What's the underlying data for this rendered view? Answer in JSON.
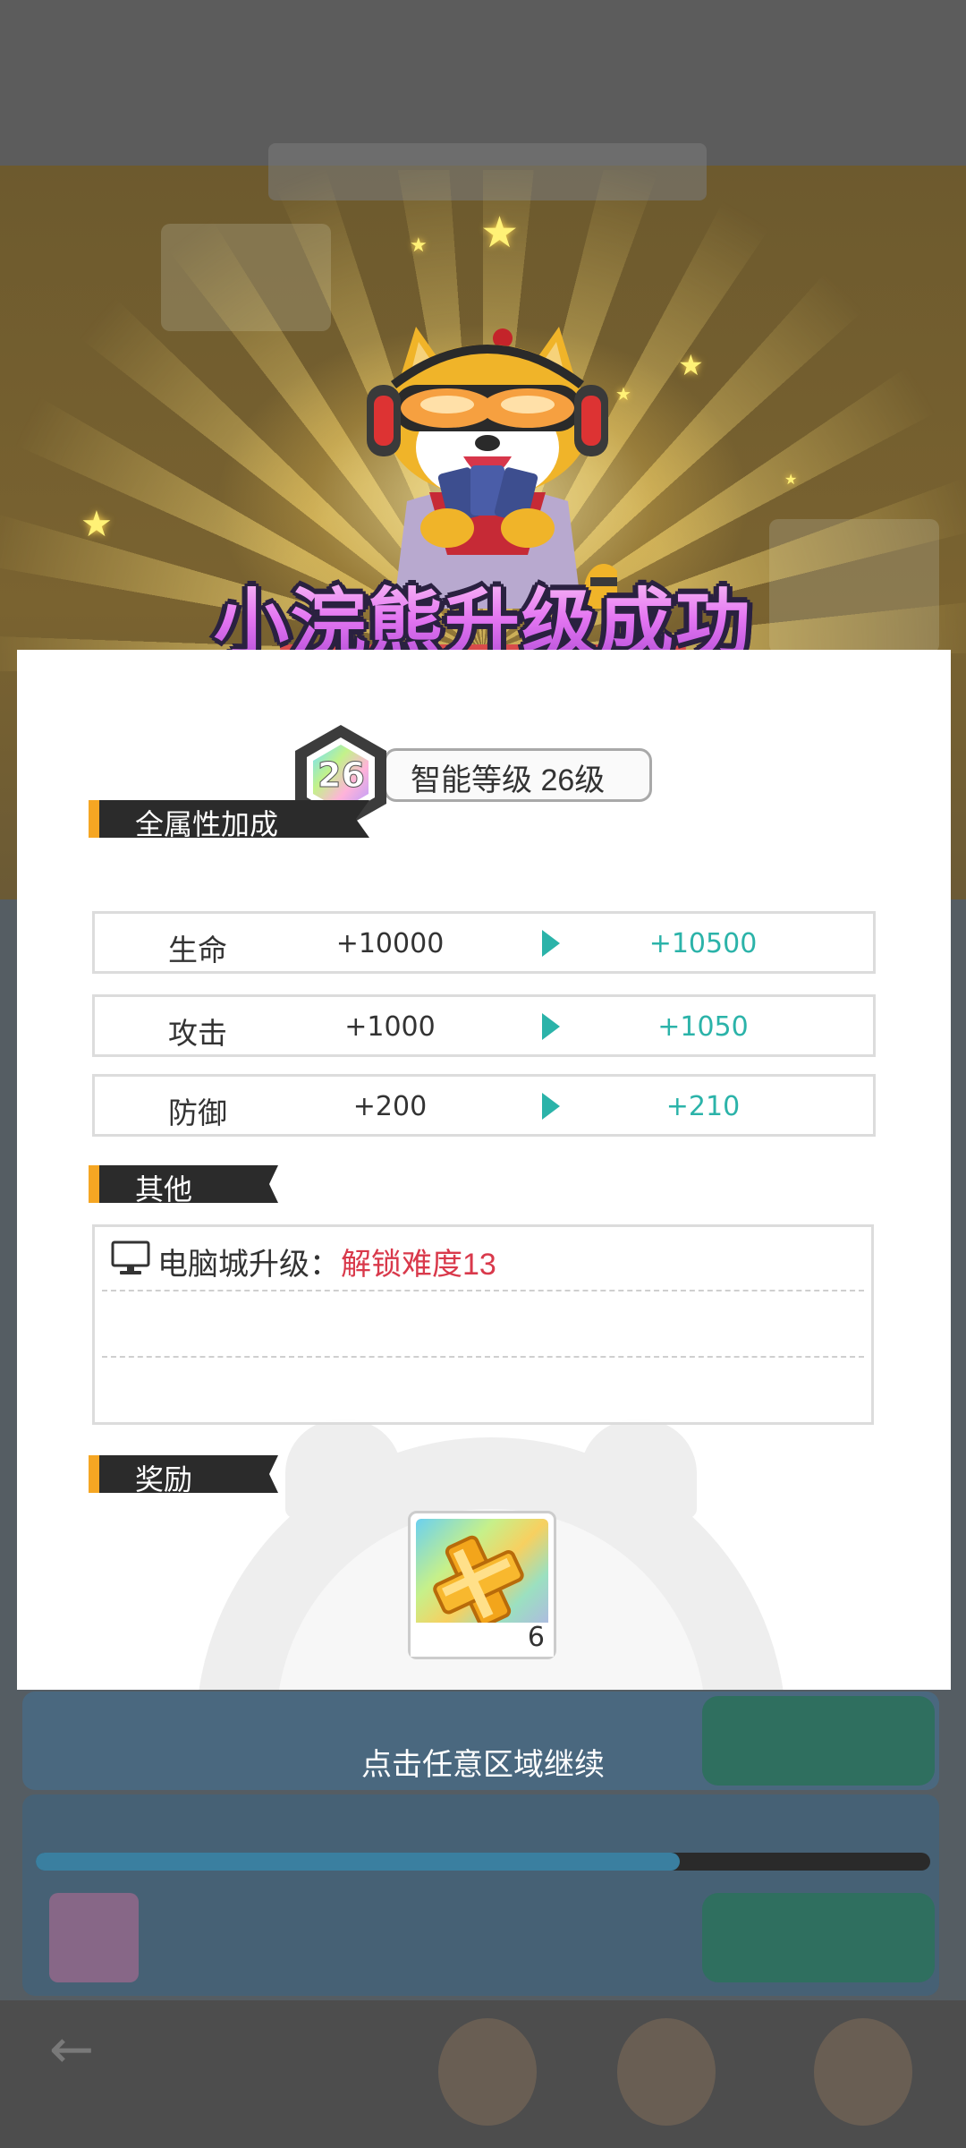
{
  "banner": {
    "title": "小浣熊升级成功"
  },
  "level": {
    "number": "26",
    "label": "智能等级 26级"
  },
  "attributes": {
    "header": "全属性加成",
    "rows": [
      {
        "name": "生命",
        "old": "+10000",
        "new": "+10500"
      },
      {
        "name": "攻击",
        "old": "+1000",
        "new": "+1050"
      },
      {
        "name": "防御",
        "old": "+200",
        "new": "+210"
      }
    ]
  },
  "other": {
    "header": "其他",
    "items": [
      {
        "icon": "monitor-icon",
        "label": "电脑城升级：",
        "value": "解锁难度13"
      }
    ]
  },
  "reward": {
    "header": "奖励",
    "items": [
      {
        "icon": "golden-cross-item-icon",
        "count": "6"
      }
    ]
  },
  "continue_hint": "点击任意区域继续",
  "colors": {
    "accent_orange": "#f5a623",
    "increase_teal": "#2bb3a9",
    "unlock_red": "#d9394b",
    "header_dark": "#2b2b2b"
  }
}
